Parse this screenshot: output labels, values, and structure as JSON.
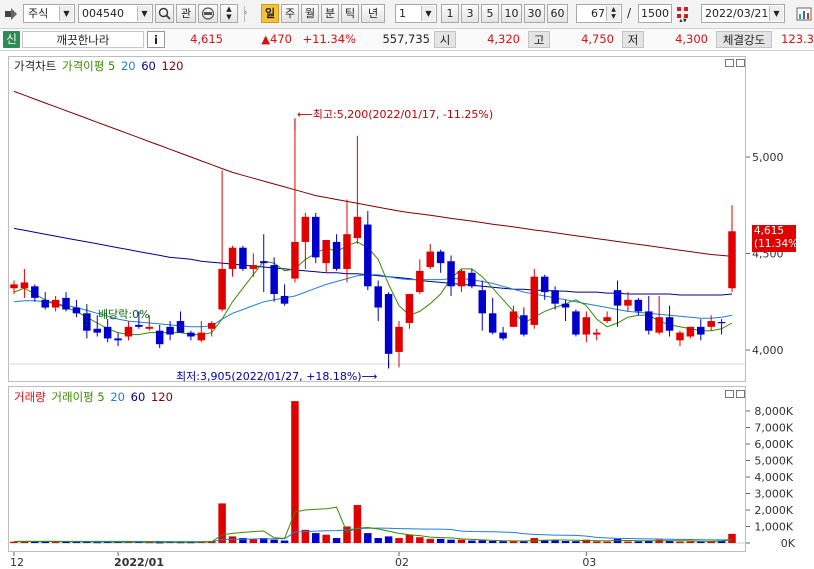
{
  "toolbar": {
    "market": "주식",
    "code": "004540",
    "btn_fav": "관",
    "periods": [
      "일",
      "주",
      "월",
      "분",
      "틱",
      "년"
    ],
    "selected_period": "일",
    "interval_value": "1",
    "minute_options": [
      "1",
      "3",
      "5",
      "10",
      "30",
      "60"
    ],
    "count_value": "67",
    "total_value": "1500",
    "separator": "/",
    "date_value": "2022/03/21"
  },
  "stock": {
    "badge": "신",
    "name": "깨끗한나라",
    "info_button": "i",
    "price": "4,615",
    "change": "▲470",
    "change_pct": "+11.34%",
    "volume": "557,735",
    "open_label": "시",
    "open": "4,320",
    "high_label": "고",
    "high": "4,750",
    "low_label": "저",
    "low": "4,300",
    "strength_label": "체결강도",
    "strength": "123.3"
  },
  "price_panel": {
    "legend": [
      {
        "text": "가격차트",
        "color": "#222222"
      },
      {
        "text": "가격이평 5",
        "color": "#3a8a00"
      },
      {
        "text": "20",
        "color": "#1f7fd8"
      },
      {
        "text": "60",
        "color": "#00008b"
      },
      {
        "text": "120",
        "color": "#800000"
      }
    ],
    "high_annotation": "최고:5,200(2022/01/17, -11.25%)",
    "low_annotation": "최저:3,905(2022/01/27, +18.18%)",
    "dividend_annotation": "배당락:0%",
    "current_price_label": "4,615",
    "current_pct_label": "(11.34%)"
  },
  "volume_panel": {
    "legend": [
      {
        "text": "거래량",
        "color": "#d81010"
      },
      {
        "text": "거래이평 5",
        "color": "#3a8a00"
      },
      {
        "text": "20",
        "color": "#1f7fd8"
      },
      {
        "text": "60",
        "color": "#00008b"
      },
      {
        "text": "120",
        "color": "#800000"
      }
    ]
  },
  "colors": {
    "up": "#e00000",
    "down": "#0000cc",
    "ma5": "#3a8a00",
    "ma20": "#1f7fd8",
    "ma60": "#00008b",
    "ma120": "#800000"
  },
  "chart_data": {
    "type": "candlestick",
    "price_axis": {
      "ticks": [
        4000,
        4500,
        5000
      ],
      "tick_labels": [
        "4,000",
        "4,500",
        "5,000"
      ]
    },
    "volume_axis": {
      "ticks": [
        0,
        1000,
        2000,
        3000,
        4000,
        5000,
        6000,
        7000,
        8000
      ],
      "tick_labels": [
        "0K",
        "1,000K",
        "2,000K",
        "3,000K",
        "4,000K",
        "5,000K",
        "6,000K",
        "7,000K",
        "8,000K"
      ]
    },
    "x_tick_labels": [
      {
        "label": "12",
        "index": 0
      },
      {
        "label": "2022/01",
        "index": 10
      },
      {
        "label": "02",
        "index": 37
      },
      {
        "label": "03",
        "index": 55
      }
    ],
    "candles": [
      {
        "o": 4320,
        "h": 4360,
        "l": 4290,
        "c": 4340,
        "v": 80
      },
      {
        "o": 4320,
        "h": 4420,
        "l": 4270,
        "c": 4350,
        "v": 120
      },
      {
        "o": 4330,
        "h": 4340,
        "l": 4250,
        "c": 4270,
        "v": 90
      },
      {
        "o": 4260,
        "h": 4300,
        "l": 4210,
        "c": 4220,
        "v": 110
      },
      {
        "o": 4220,
        "h": 4280,
        "l": 4200,
        "c": 4260,
        "v": 95
      },
      {
        "o": 4270,
        "h": 4300,
        "l": 4200,
        "c": 4210,
        "v": 70
      },
      {
        "o": 4220,
        "h": 4260,
        "l": 4170,
        "c": 4190,
        "v": 60
      },
      {
        "o": 4190,
        "h": 4230,
        "l": 4060,
        "c": 4100,
        "v": 80
      },
      {
        "o": 4110,
        "h": 4180,
        "l": 4070,
        "c": 4090,
        "v": 50
      },
      {
        "o": 4120,
        "h": 4160,
        "l": 4040,
        "c": 4060,
        "v": 60
      },
      {
        "o": 4060,
        "h": 4090,
        "l": 4020,
        "c": 4050,
        "v": 90
      },
      {
        "o": 4070,
        "h": 4150,
        "l": 4050,
        "c": 4120,
        "v": 70
      },
      {
        "o": 4130,
        "h": 4200,
        "l": 4110,
        "c": 4120,
        "v": 60
      },
      {
        "o": 4110,
        "h": 4180,
        "l": 4100,
        "c": 4120,
        "v": 50
      },
      {
        "o": 4100,
        "h": 4130,
        "l": 4010,
        "c": 4030,
        "v": 40
      },
      {
        "o": 4120,
        "h": 4150,
        "l": 4050,
        "c": 4080,
        "v": 60
      },
      {
        "o": 4150,
        "h": 4200,
        "l": 4100,
        "c": 4090,
        "v": 50
      },
      {
        "o": 4090,
        "h": 4100,
        "l": 4050,
        "c": 4070,
        "v": 50
      },
      {
        "o": 4050,
        "h": 4150,
        "l": 4040,
        "c": 4090,
        "v": 70
      },
      {
        "o": 4110,
        "h": 4150,
        "l": 4070,
        "c": 4140,
        "v": 120
      },
      {
        "o": 4210,
        "h": 4930,
        "l": 4200,
        "c": 4420,
        "v": 2400
      },
      {
        "o": 4420,
        "h": 4540,
        "l": 4380,
        "c": 4530,
        "v": 400
      },
      {
        "o": 4530,
        "h": 4540,
        "l": 4410,
        "c": 4420,
        "v": 300
      },
      {
        "o": 4420,
        "h": 4500,
        "l": 4380,
        "c": 4440,
        "v": 250
      },
      {
        "o": 4460,
        "h": 4600,
        "l": 4300,
        "c": 4450,
        "v": 300
      },
      {
        "o": 4440,
        "h": 4480,
        "l": 4250,
        "c": 4290,
        "v": 200
      },
      {
        "o": 4280,
        "h": 4340,
        "l": 4230,
        "c": 4240,
        "v": 150
      },
      {
        "o": 4370,
        "h": 5200,
        "l": 4350,
        "c": 4560,
        "v": 8600
      },
      {
        "o": 4560,
        "h": 4710,
        "l": 4420,
        "c": 4690,
        "v": 800
      },
      {
        "o": 4690,
        "h": 4710,
        "l": 4450,
        "c": 4480,
        "v": 600
      },
      {
        "o": 4450,
        "h": 4570,
        "l": 4400,
        "c": 4570,
        "v": 500
      },
      {
        "o": 4560,
        "h": 4600,
        "l": 4410,
        "c": 4420,
        "v": 300
      },
      {
        "o": 4420,
        "h": 4780,
        "l": 4350,
        "c": 4600,
        "v": 1000
      },
      {
        "o": 4580,
        "h": 5110,
        "l": 4550,
        "c": 4690,
        "v": 2300
      },
      {
        "o": 4650,
        "h": 4720,
        "l": 4310,
        "c": 4330,
        "v": 600
      },
      {
        "o": 4330,
        "h": 4360,
        "l": 4150,
        "c": 4220,
        "v": 300
      },
      {
        "o": 4290,
        "h": 4300,
        "l": 3905,
        "c": 3980,
        "v": 400
      },
      {
        "o": 3990,
        "h": 4150,
        "l": 3910,
        "c": 4120,
        "v": 300
      },
      {
        "o": 4140,
        "h": 4290,
        "l": 4110,
        "c": 4290,
        "v": 500
      },
      {
        "o": 4300,
        "h": 4470,
        "l": 4290,
        "c": 4410,
        "v": 350
      },
      {
        "o": 4430,
        "h": 4550,
        "l": 4420,
        "c": 4510,
        "v": 250
      },
      {
        "o": 4510,
        "h": 4520,
        "l": 4400,
        "c": 4450,
        "v": 250
      },
      {
        "o": 4460,
        "h": 4490,
        "l": 4280,
        "c": 4330,
        "v": 200
      },
      {
        "o": 4330,
        "h": 4420,
        "l": 4300,
        "c": 4410,
        "v": 200
      },
      {
        "o": 4400,
        "h": 4420,
        "l": 4320,
        "c": 4330,
        "v": 150
      },
      {
        "o": 4310,
        "h": 4360,
        "l": 4100,
        "c": 4190,
        "v": 160
      },
      {
        "o": 4190,
        "h": 4270,
        "l": 4080,
        "c": 4090,
        "v": 120
      },
      {
        "o": 4090,
        "h": 4120,
        "l": 4050,
        "c": 4060,
        "v": 110
      },
      {
        "o": 4120,
        "h": 4230,
        "l": 4120,
        "c": 4200,
        "v": 100
      },
      {
        "o": 4180,
        "h": 4220,
        "l": 4070,
        "c": 4080,
        "v": 90
      },
      {
        "o": 4130,
        "h": 4420,
        "l": 4110,
        "c": 4380,
        "v": 300
      },
      {
        "o": 4380,
        "h": 4390,
        "l": 4260,
        "c": 4300,
        "v": 180
      },
      {
        "o": 4310,
        "h": 4330,
        "l": 4210,
        "c": 4240,
        "v": 150
      },
      {
        "o": 4240,
        "h": 4260,
        "l": 4150,
        "c": 4220,
        "v": 120
      },
      {
        "o": 4200,
        "h": 4210,
        "l": 4070,
        "c": 4080,
        "v": 110
      },
      {
        "o": 4080,
        "h": 4200,
        "l": 4040,
        "c": 4170,
        "v": 200
      },
      {
        "o": 4080,
        "h": 4110,
        "l": 4050,
        "c": 4090,
        "v": 90
      },
      {
        "o": 4150,
        "h": 4200,
        "l": 4140,
        "c": 4170,
        "v": 80
      },
      {
        "o": 4310,
        "h": 4360,
        "l": 4120,
        "c": 4230,
        "v": 250
      },
      {
        "o": 4230,
        "h": 4300,
        "l": 4200,
        "c": 4260,
        "v": 90
      },
      {
        "o": 4260,
        "h": 4270,
        "l": 4180,
        "c": 4200,
        "v": 100
      },
      {
        "o": 4200,
        "h": 4280,
        "l": 4080,
        "c": 4100,
        "v": 120
      },
      {
        "o": 4090,
        "h": 4280,
        "l": 4080,
        "c": 4170,
        "v": 200
      },
      {
        "o": 4170,
        "h": 4230,
        "l": 4070,
        "c": 4100,
        "v": 150
      },
      {
        "o": 4050,
        "h": 4100,
        "l": 4020,
        "c": 4090,
        "v": 80
      },
      {
        "o": 4070,
        "h": 4120,
        "l": 4060,
        "c": 4120,
        "v": 90
      },
      {
        "o": 4120,
        "h": 4160,
        "l": 4050,
        "c": 4080,
        "v": 80
      },
      {
        "o": 4120,
        "h": 4180,
        "l": 4100,
        "c": 4150,
        "v": 100
      },
      {
        "o": 4145,
        "h": 4160,
        "l": 4080,
        "c": 4140,
        "v": 120
      },
      {
        "o": 4320,
        "h": 4750,
        "l": 4300,
        "c": 4615,
        "v": 557
      }
    ],
    "ma": {
      "ma5": [
        4300,
        4320,
        4290,
        4260,
        4240,
        4220,
        4200,
        4170,
        4140,
        4110,
        4090,
        4080,
        4080,
        4090,
        4090,
        4090,
        4090,
        4080,
        4080,
        4090,
        4160,
        4250,
        4320,
        4390,
        4460,
        4450,
        4410,
        4420,
        4470,
        4500,
        4530,
        4510,
        4540,
        4560,
        4530,
        4470,
        4340,
        4230,
        4180,
        4200,
        4240,
        4290,
        4370,
        4420,
        4420,
        4380,
        4320,
        4260,
        4200,
        4140,
        4170,
        4200,
        4220,
        4240,
        4260,
        4230,
        4160,
        4120,
        4140,
        4170,
        4180,
        4180,
        4150,
        4130,
        4120,
        4110,
        4100,
        4100,
        4110,
        4140
      ],
      "ma20": [
        4250,
        4255,
        4255,
        4250,
        4240,
        4230,
        4220,
        4205,
        4190,
        4175,
        4160,
        4150,
        4145,
        4140,
        4135,
        4130,
        4125,
        4120,
        4120,
        4125,
        4160,
        4190,
        4210,
        4230,
        4250,
        4260,
        4270,
        4280,
        4300,
        4320,
        4340,
        4355,
        4370,
        4385,
        4390,
        4390,
        4380,
        4370,
        4365,
        4365,
        4365,
        4365,
        4370,
        4370,
        4365,
        4355,
        4345,
        4330,
        4315,
        4300,
        4290,
        4280,
        4270,
        4260,
        4250,
        4240,
        4230,
        4220,
        4210,
        4200,
        4195,
        4190,
        4185,
        4180,
        4175,
        4170,
        4165,
        4165,
        4170,
        4180
      ],
      "ma60": [
        4630,
        4620,
        4610,
        4600,
        4590,
        4580,
        4570,
        4560,
        4550,
        4540,
        4530,
        4520,
        4510,
        4500,
        4490,
        4480,
        4475,
        4470,
        4460,
        4455,
        4450,
        4445,
        4440,
        4435,
        4430,
        4425,
        4420,
        4415,
        4410,
        4405,
        4400,
        4400,
        4395,
        4395,
        4390,
        4385,
        4380,
        4375,
        4370,
        4360,
        4355,
        4350,
        4345,
        4340,
        4335,
        4330,
        4325,
        4320,
        4315,
        4315,
        4310,
        4310,
        4305,
        4305,
        4300,
        4300,
        4300,
        4295,
        4295,
        4290,
        4290,
        4290,
        4290,
        4290,
        4285,
        4285,
        4285,
        4285,
        4285,
        4290
      ],
      "ma120": [
        5340,
        5320,
        5300,
        5280,
        5260,
        5240,
        5220,
        5200,
        5180,
        5160,
        5140,
        5120,
        5100,
        5080,
        5060,
        5040,
        5020,
        5000,
        4980,
        4960,
        4940,
        4920,
        4905,
        4890,
        4875,
        4860,
        4845,
        4830,
        4815,
        4800,
        4790,
        4780,
        4770,
        4760,
        4750,
        4740,
        4730,
        4720,
        4712,
        4705,
        4698,
        4690,
        4682,
        4675,
        4668,
        4660,
        4652,
        4645,
        4638,
        4630,
        4622,
        4615,
        4607,
        4600,
        4592,
        4585,
        4577,
        4570,
        4562,
        4555,
        4547,
        4540,
        4532,
        4525,
        4517,
        4510,
        4502,
        4495,
        4490,
        4485
      ]
    },
    "volume_ma": {
      "ma5": [
        90,
        95,
        100,
        100,
        95,
        90,
        80,
        75,
        70,
        65,
        60,
        60,
        60,
        55,
        55,
        55,
        55,
        55,
        60,
        70,
        500,
        580,
        640,
        690,
        730,
        320,
        280,
        1880,
        2000,
        2050,
        2080,
        2170,
        640,
        900,
        940,
        850,
        720,
        580,
        500,
        450,
        360,
        330,
        310,
        250,
        220,
        190,
        160,
        140,
        130,
        120,
        150,
        170,
        180,
        180,
        170,
        150,
        140,
        130,
        150,
        150,
        140,
        140,
        140,
        140,
        140,
        130,
        110,
        100,
        120,
        190
      ],
      "ma20": [
        100,
        100,
        100,
        100,
        100,
        100,
        100,
        100,
        95,
        95,
        95,
        95,
        90,
        90,
        90,
        85,
        85,
        85,
        85,
        90,
        200,
        220,
        230,
        240,
        250,
        260,
        260,
        660,
        690,
        720,
        740,
        750,
        790,
        870,
        890,
        900,
        890,
        870,
        860,
        850,
        840,
        840,
        820,
        720,
        700,
        690,
        680,
        660,
        640,
        560,
        520,
        500,
        480,
        470,
        460,
        420,
        340,
        300,
        280,
        270,
        260,
        250,
        240,
        230,
        220,
        210,
        200,
        190,
        190,
        200
      ]
    }
  }
}
